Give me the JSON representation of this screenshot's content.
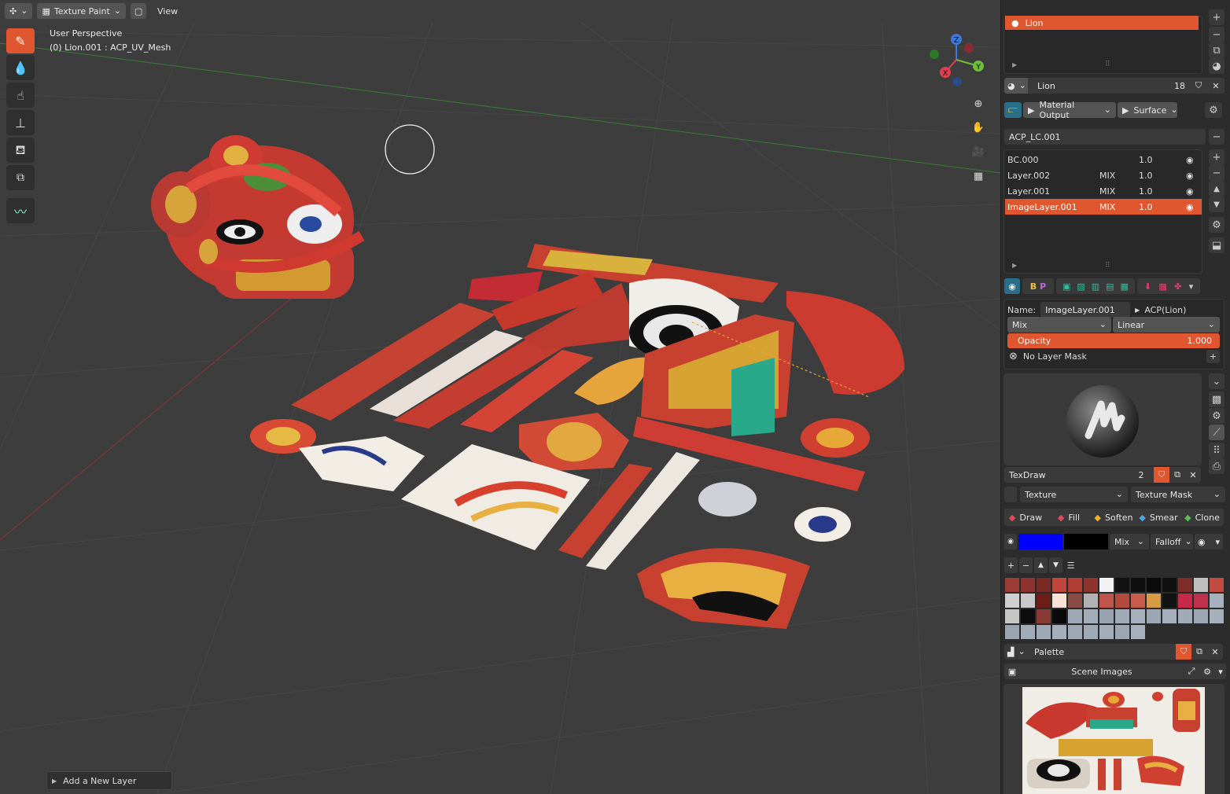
{
  "header": {
    "mode_label": "Texture Paint",
    "view_label": "View"
  },
  "viewport": {
    "perspective_label": "User Perspective",
    "object_label": "(0) Lion.001 : ACP_UV_Mesh",
    "add_layer_label": "Add a New Layer",
    "gizmo": {
      "x": "X",
      "y": "Y",
      "z": "Z"
    }
  },
  "tools": [
    "draw-brush-icon",
    "soften-icon",
    "smear-icon",
    "clone-stamp-icon",
    "fill-icon",
    "mask-icon",
    "annotate-icon"
  ],
  "panel": {
    "material_slot": "Lion",
    "material_name": "Lion",
    "material_users": "18",
    "node_output": "Material Output",
    "node_surface": "Surface",
    "layer_channel": "ACP_LC.001",
    "layers": [
      {
        "name": "BC.000",
        "mode": "",
        "value": "1.0",
        "selected": false
      },
      {
        "name": "Layer.002",
        "mode": "MIX",
        "value": "1.0",
        "selected": false
      },
      {
        "name": "Layer.001",
        "mode": "MIX",
        "value": "1.0",
        "selected": false
      },
      {
        "name": "ImageLayer.001",
        "mode": "MIX",
        "value": "1.0",
        "selected": true
      }
    ],
    "props": {
      "name_label": "Name:",
      "name_value": "ImageLayer.001",
      "parent": "ACP(Lion)",
      "blend": "Mix",
      "interp": "Linear",
      "opacity_label": "Opacity",
      "opacity_value": "1.000",
      "mask_label": "No Layer Mask"
    },
    "brush": {
      "name": "TexDraw",
      "users": "2",
      "texture_label": "Texture",
      "texture_mask_label": "Texture Mask"
    },
    "modes": [
      "Draw",
      "Fill",
      "Soften",
      "Smear",
      "Clone"
    ],
    "color": {
      "primary": "#0000ff",
      "secondary": "#000000",
      "blend": "Mix",
      "falloff": "Falloff"
    },
    "palette": {
      "name": "Palette",
      "swatches": [
        "#9a3b35",
        "#8e332d",
        "#7a2a25",
        "#c0463d",
        "#b03c33",
        "#8f332d",
        "#f2f2f2",
        "#121212",
        "#0f0f0f",
        "#0b0b0b",
        "#111111",
        "#7c2d28",
        "#bfbfbf",
        "#c24a40",
        "#cfcfcf",
        "#c9c9c9",
        "#6e1c18",
        "#f6e3d6",
        "#8a4b46",
        "#b2b2b2",
        "#c0544a",
        "#b24a3d",
        "#c85c4a",
        "#d89a46",
        "#121212",
        "#c52a48",
        "#c0304a",
        "#a7b1bd",
        "#c6c6c6",
        "#0d0d0d",
        "#8a3a34",
        "#0a0a0a",
        "#9ea8b4",
        "#a3adb9",
        "#9aa4b0",
        "#a0aab6",
        "#a8b2be",
        "#9ca6b2",
        "#a5afbb",
        "#a1abb7",
        "#9da7b3",
        "#a6b0bc",
        "#9ba5b1",
        "#a2acb8",
        "#9fa9b5",
        "#a4aeba",
        "#9ea8b4",
        "#a0aab6",
        "#a3adb9",
        "#9ca6b2",
        "#a7b1bd"
      ]
    },
    "images_label": "Scene Images"
  }
}
